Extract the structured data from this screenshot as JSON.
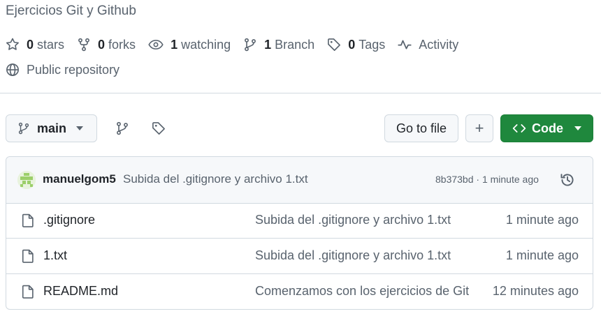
{
  "repo": {
    "description": "Ejercicios Git y Github",
    "visibility": "Public repository"
  },
  "stats": {
    "stars_count": "0",
    "stars_label": "stars",
    "forks_count": "0",
    "forks_label": "forks",
    "watching_count": "1",
    "watching_label": "watching",
    "branch_count": "1",
    "branch_label": "Branch",
    "tags_count": "0",
    "tags_label": "Tags",
    "activity_label": "Activity"
  },
  "toolbar": {
    "branch": "main",
    "goto_file": "Go to file",
    "add": "+",
    "code": "Code"
  },
  "latest_commit": {
    "author": "manuelgom5",
    "message": "Subida del .gitignore y archivo 1.txt",
    "meta": "8b373bd · 1 minute ago"
  },
  "files": [
    {
      "name": ".gitignore",
      "message": "Subida del .gitignore y archivo 1.txt",
      "age": "1 minute ago"
    },
    {
      "name": "1.txt",
      "message": "Subida del .gitignore y archivo 1.txt",
      "age": "1 minute ago"
    },
    {
      "name": "README.md",
      "message": "Comenzamos con los ejercicios de Git",
      "age": "12 minutes ago"
    }
  ],
  "icons": {
    "star": "star-icon",
    "fork": "fork-icon",
    "eye": "eye-icon",
    "branch": "branch-icon",
    "tag": "tag-icon",
    "pulse": "pulse-icon",
    "globe": "globe-icon",
    "file": "file-icon",
    "history": "history-icon",
    "code": "code-icon"
  },
  "colors": {
    "primary": "#1f883d",
    "muted": "#59636e",
    "border": "#d1d9e0"
  }
}
